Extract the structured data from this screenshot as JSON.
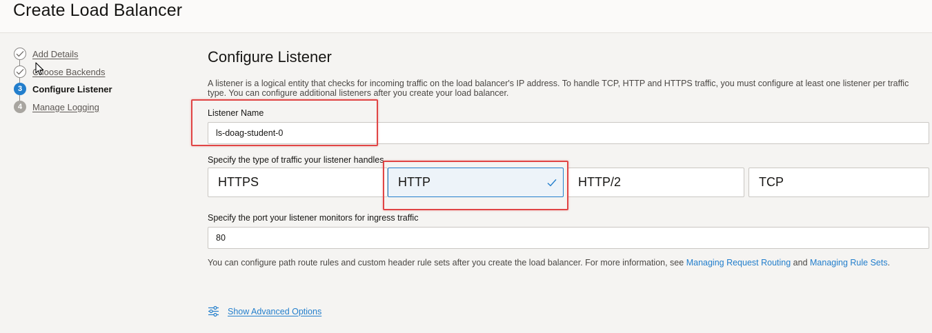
{
  "header": {
    "title": "Create Load Balancer"
  },
  "steps": [
    {
      "number": "",
      "label": "Add Details",
      "status": "completed"
    },
    {
      "number": "",
      "label": "Choose Backends",
      "status": "completed"
    },
    {
      "number": "3",
      "label": "Configure Listener",
      "status": "current"
    },
    {
      "number": "4",
      "label": "Manage Logging",
      "status": "upcoming"
    }
  ],
  "main": {
    "title": "Configure Listener",
    "description": "A listener is a logical entity that checks for incoming traffic on the load balancer's IP address. To handle TCP, HTTP and HTTPS traffic, you must configure at least one listener per traffic type. You can configure additional listeners after you create your load balancer.",
    "listener_name": {
      "label": "Listener Name",
      "value": "ls-doag-student-0"
    },
    "traffic": {
      "label": "Specify the type of traffic your listener handles",
      "options": [
        "HTTPS",
        "HTTP",
        "HTTP/2",
        "TCP"
      ],
      "selected": "HTTP"
    },
    "port": {
      "label": "Specify the port your listener monitors for ingress traffic",
      "value": "80"
    },
    "help": {
      "text_before": "You can configure path route rules and custom header rule sets after you create the load balancer. For more information, see ",
      "link1": "Managing Request Routing",
      "text_middle": " and ",
      "link2": "Managing Rule Sets",
      "text_after": "."
    },
    "advanced_link": "Show Advanced Options"
  },
  "colors": {
    "accent": "#227ecc",
    "annotation": "#e04444",
    "selected_bg": "#edf3f9"
  },
  "icons": {
    "completed_step": "check-circle-icon",
    "selected_option": "check-icon",
    "advanced_options": "sliders-icon",
    "pointer": "mouse-cursor-icon"
  }
}
